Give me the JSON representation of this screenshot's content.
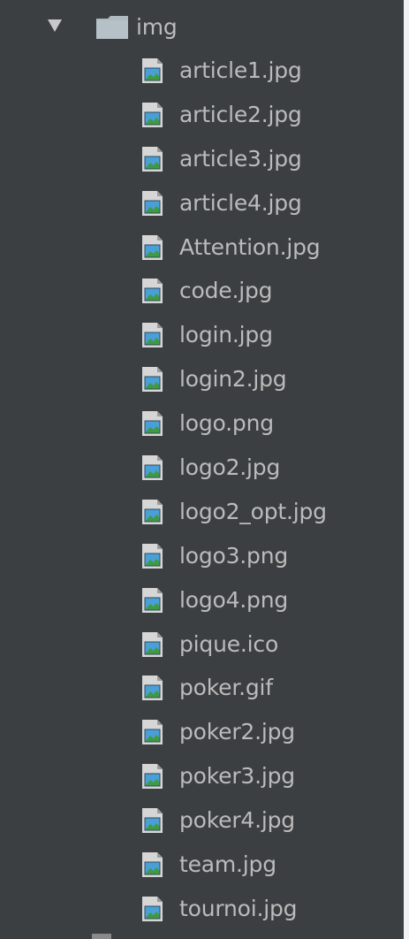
{
  "folder": {
    "name": "img",
    "expanded": true
  },
  "files": [
    {
      "name": "article1.jpg"
    },
    {
      "name": "article2.jpg"
    },
    {
      "name": "article3.jpg"
    },
    {
      "name": "article4.jpg"
    },
    {
      "name": "Attention.jpg"
    },
    {
      "name": "code.jpg"
    },
    {
      "name": "login.jpg"
    },
    {
      "name": "login2.jpg"
    },
    {
      "name": "logo.png"
    },
    {
      "name": "logo2.jpg"
    },
    {
      "name": "logo2_opt.jpg"
    },
    {
      "name": "logo3.png"
    },
    {
      "name": "logo4.png"
    },
    {
      "name": "pique.ico"
    },
    {
      "name": "poker.gif"
    },
    {
      "name": "poker2.jpg"
    },
    {
      "name": "poker3.jpg"
    },
    {
      "name": "poker4.jpg"
    },
    {
      "name": "team.jpg"
    },
    {
      "name": "tournoi.jpg"
    }
  ],
  "colors": {
    "panel_background": "#3c3f41",
    "text": "#bbbbbb",
    "folder_icon": "#aeb9c0",
    "chevron": "#c8c8c8",
    "image_icon_sky": "#4a9fd6",
    "image_icon_hill": "#3f9a43"
  },
  "icons": {
    "folder": "folder-icon",
    "chevron": "chevron-down-icon",
    "file": "image-file-icon"
  }
}
